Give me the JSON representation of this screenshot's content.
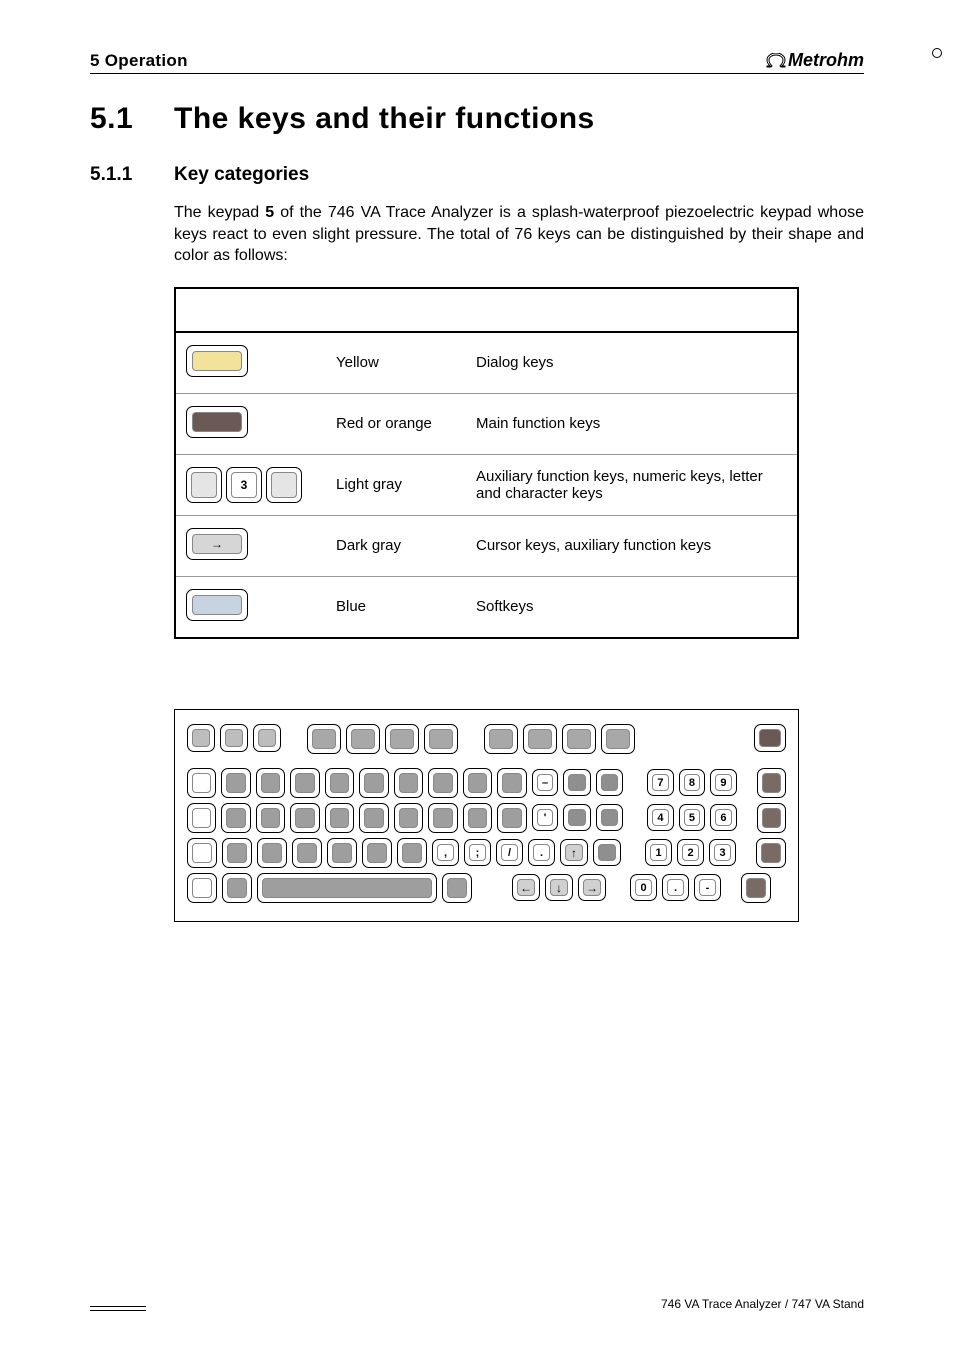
{
  "header": {
    "left": "5  Operation",
    "brand": "Metrohm"
  },
  "h1": {
    "num": "5.1",
    "text": "The keys and their functions"
  },
  "h2": {
    "num": "5.1.1",
    "text": "Key categories"
  },
  "para": {
    "a": "The keypad ",
    "b": "5",
    "c": " of the 746 VA Trace Analyzer is a splash-waterproof piezoelectric keypad whose keys react to even slight pressure. The total of 76 keys can be distinguished by their shape and color as follows:"
  },
  "table": {
    "rows": [
      {
        "color": "Yellow",
        "desc": "Dialog keys",
        "fill": "#f2e39a"
      },
      {
        "color": "Red or orange",
        "desc": "Main function keys",
        "fill": "#6b5956"
      },
      {
        "color": "Light gray",
        "desc": "Auxiliary function keys, numeric keys, letter and character keys",
        "fill": "#cfcfcf",
        "label": "3",
        "pair": true
      },
      {
        "color": "Dark gray",
        "desc": "Cursor keys, auxiliary function keys",
        "fill": "#8f8f8f",
        "arrow": true
      },
      {
        "color": "Blue",
        "desc": "Softkeys",
        "fill": "#b7c7d9"
      }
    ]
  },
  "numpad": {
    "r1": [
      "7",
      "8",
      "9"
    ],
    "r2": [
      "4",
      "5",
      "6"
    ],
    "r3": [
      "1",
      "2",
      "3"
    ],
    "r4": [
      "0",
      ".",
      "-"
    ]
  },
  "sym": {
    "minus": "–",
    "apos": "'",
    "comma": ",",
    "semi": ";",
    "slash": "/",
    "dot": ".",
    "up": "↑",
    "left": "←",
    "down": "↓",
    "right": "→"
  },
  "footer": {
    "text": "746 VA Trace Analyzer / 747 VA Stand"
  }
}
